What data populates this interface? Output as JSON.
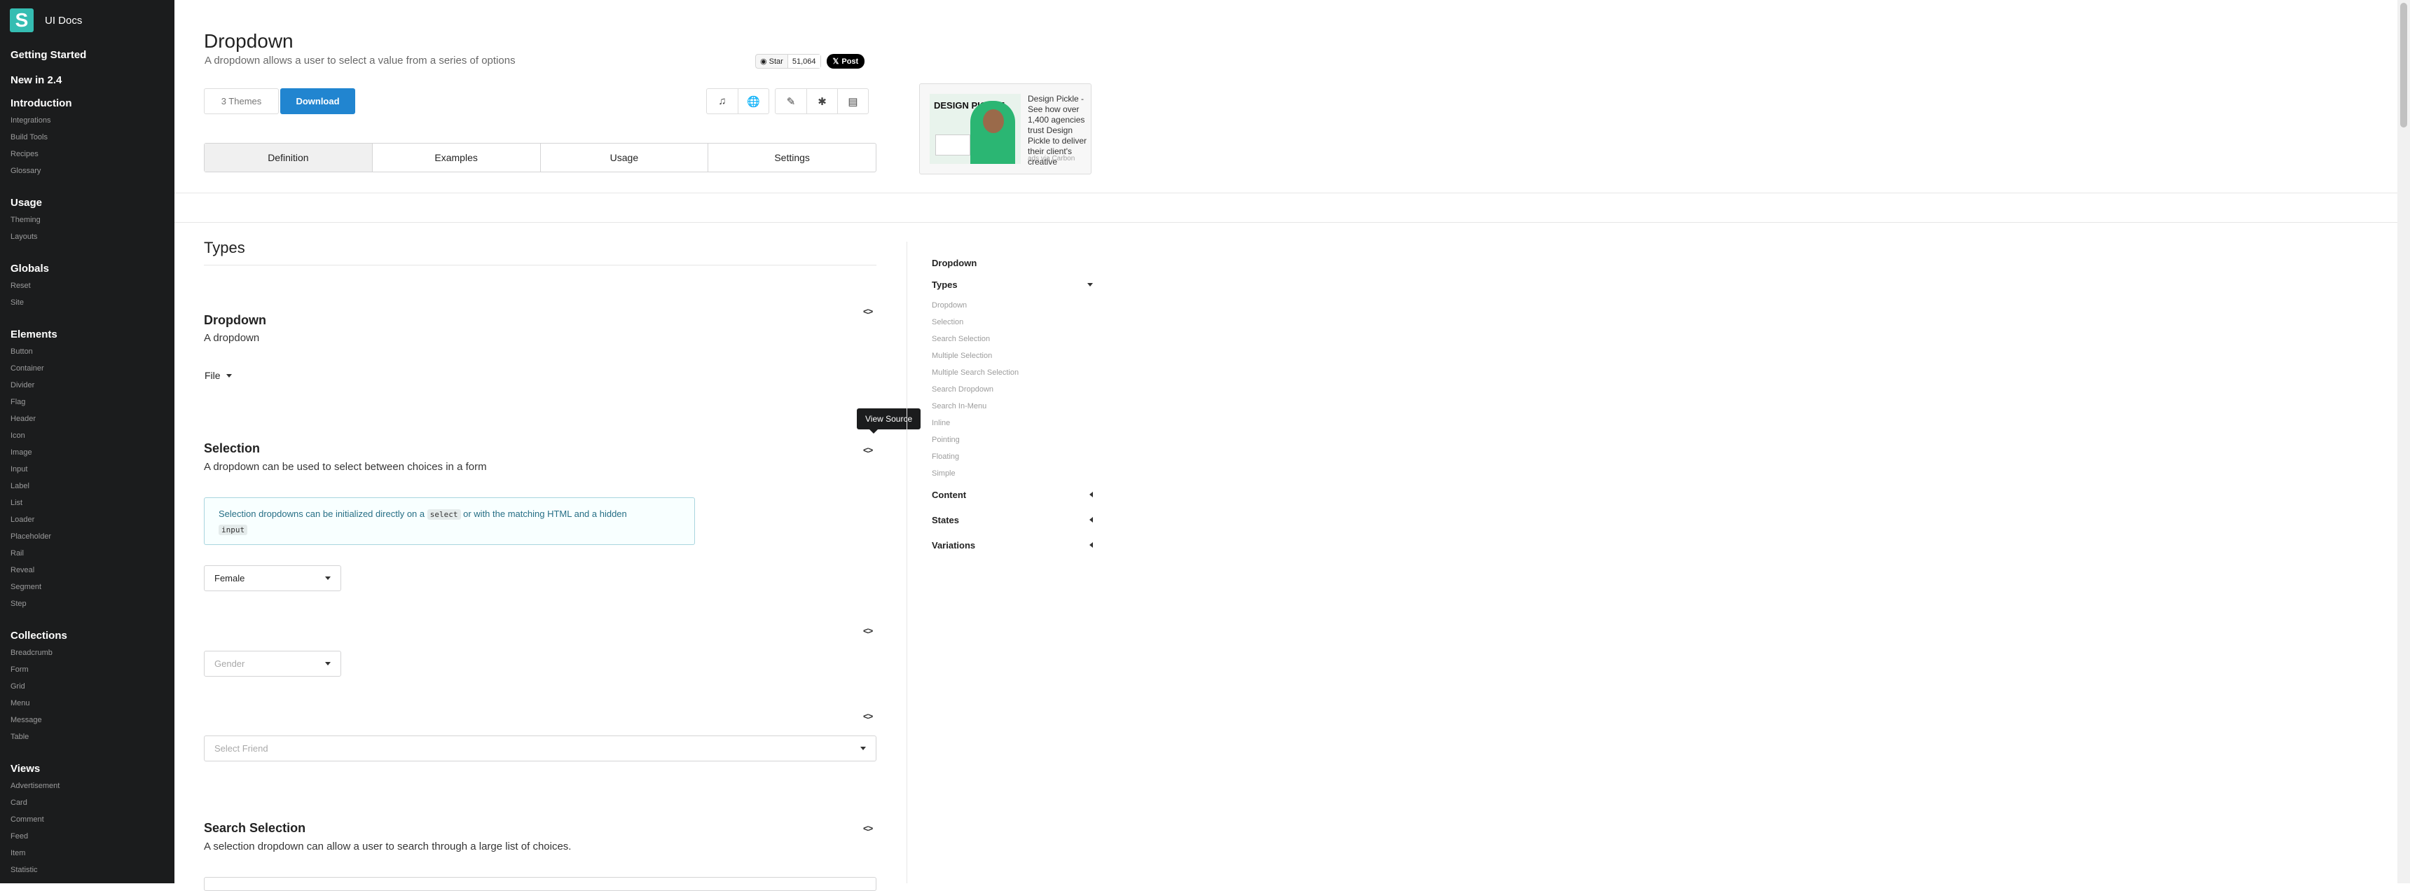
{
  "sidebar": {
    "brand": "UI Docs",
    "logo_letter": "S",
    "top_items": [
      "Getting Started",
      "New in 2.4"
    ],
    "groups": [
      {
        "title": "Introduction",
        "items": [
          "Integrations",
          "Build Tools",
          "Recipes",
          "Glossary"
        ]
      },
      {
        "title": "Usage",
        "items": [
          "Theming",
          "Layouts"
        ]
      },
      {
        "title": "Globals",
        "items": [
          "Reset",
          "Site"
        ]
      },
      {
        "title": "Elements",
        "items": [
          "Button",
          "Container",
          "Divider",
          "Flag",
          "Header",
          "Icon",
          "Image",
          "Input",
          "Label",
          "List",
          "Loader",
          "Placeholder",
          "Rail",
          "Reveal",
          "Segment",
          "Step"
        ]
      },
      {
        "title": "Collections",
        "items": [
          "Breadcrumb",
          "Form",
          "Grid",
          "Menu",
          "Message",
          "Table"
        ]
      },
      {
        "title": "Views",
        "items": [
          "Advertisement",
          "Card",
          "Comment",
          "Feed",
          "Item",
          "Statistic"
        ]
      }
    ]
  },
  "header": {
    "title": "Dropdown",
    "subtitle": "A dropdown allows a user to select a value from a series of options",
    "github": {
      "star_label": "Star",
      "star_count": "51,064",
      "post_label": "Post"
    },
    "themes_button": "3 Themes",
    "download_button": "Download",
    "tabs": [
      "Definition",
      "Examples",
      "Usage",
      "Settings"
    ],
    "active_tab": "Definition"
  },
  "ad": {
    "image_text": "DESIGN PICKLE",
    "text": "Design Pickle - See how over 1,400 agencies trust Design Pickle to deliver their client's creative",
    "via": "ads via Carbon"
  },
  "content": {
    "section_title": "Types",
    "examples": [
      {
        "title": "Dropdown",
        "desc": "A dropdown",
        "control": "File"
      },
      {
        "title": "Selection",
        "desc": "A dropdown can be used to select between choices in a form"
      },
      {
        "title": "Search Selection",
        "desc": "A selection dropdown can allow a user to search through a large list of choices."
      }
    ],
    "info_text_1": "Selection dropdowns can be initialized directly on a",
    "info_code_1": "select",
    "info_text_2": "or with the matching HTML and a hidden",
    "info_code_2": "input",
    "selects": {
      "female": "Female",
      "gender": "Gender",
      "friend": "Select Friend"
    },
    "tooltip": "View Source",
    "code_icon": "<>"
  },
  "toc": {
    "top": "Dropdown",
    "sections": [
      {
        "title": "Types",
        "expanded": true,
        "items": [
          "Dropdown",
          "Selection",
          "Search Selection",
          "Multiple Selection",
          "Multiple Search Selection",
          "Search Dropdown",
          "Search In-Menu",
          "Inline",
          "Pointing",
          "Floating",
          "Simple"
        ]
      },
      {
        "title": "Content",
        "expanded": false
      },
      {
        "title": "States",
        "expanded": false
      },
      {
        "title": "Variations",
        "expanded": false
      }
    ]
  },
  "colors": {
    "sidebar_bg": "#1b1c1d",
    "primary": "#2185d0",
    "logo": "#35bdb2",
    "info_border": "#a9d5de"
  }
}
